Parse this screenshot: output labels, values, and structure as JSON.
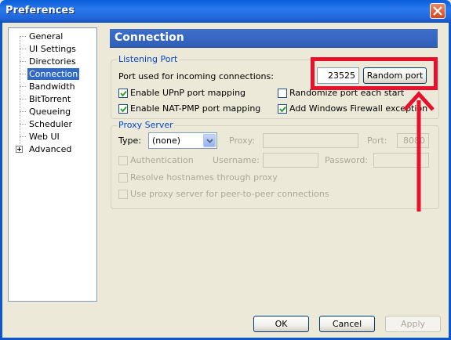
{
  "window": {
    "title": "Preferences"
  },
  "sidebar": {
    "items": [
      {
        "label": "General"
      },
      {
        "label": "UI Settings"
      },
      {
        "label": "Directories"
      },
      {
        "label": "Connection"
      },
      {
        "label": "Bandwidth"
      },
      {
        "label": "BitTorrent"
      },
      {
        "label": "Queueing"
      },
      {
        "label": "Scheduler"
      },
      {
        "label": "Web UI"
      },
      {
        "label": "Advanced"
      }
    ],
    "selected": "Connection"
  },
  "panel": {
    "title": "Connection"
  },
  "listening": {
    "group_label": "Listening Port",
    "port_label": "Port used for incoming connections:",
    "port_value": "23525",
    "random_label": "Random port",
    "upnp_label": "Enable UPnP port mapping",
    "upnp_checked": true,
    "randomize_label": "Randomize port each start",
    "randomize_checked": false,
    "natpmp_label": "Enable NAT-PMP port mapping",
    "natpmp_checked": true,
    "firewall_label": "Add Windows Firewall exception",
    "firewall_checked": true
  },
  "proxy": {
    "group_label": "Proxy Server",
    "type_label": "Type:",
    "type_value": "(none)",
    "proxy_label": "Proxy:",
    "port_label": "Port:",
    "port_value": "8080",
    "auth_label": "Authentication",
    "username_label": "Username:",
    "password_label": "Password:",
    "resolve_label": "Resolve hostnames through proxy",
    "peer_label": "Use proxy server for peer-to-peer connections"
  },
  "footer": {
    "ok_label": "OK",
    "cancel_label": "Cancel",
    "apply_label": "Apply"
  },
  "colors": {
    "annotation": "#e8102c",
    "header": "#2f5fb8",
    "selection": "#316ac5"
  }
}
